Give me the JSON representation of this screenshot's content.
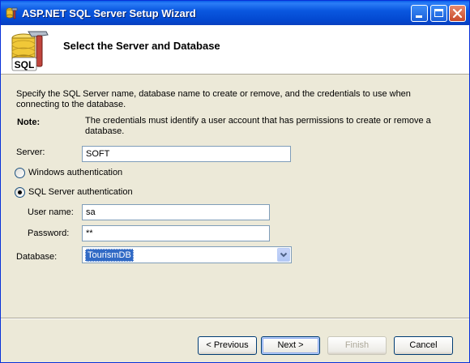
{
  "window": {
    "title": "ASP.NET SQL Server Setup Wizard"
  },
  "header": {
    "title": "Select the Server and Database",
    "icon_text": "SQL"
  },
  "intro": "Specify the SQL Server name, database name to create or remove, and the credentials to use when connecting to the database.",
  "note": {
    "label": "Note:",
    "text": "The credentials must identify a user account that has permissions to create or remove a database."
  },
  "server": {
    "label": "Server:",
    "value": "SOFT"
  },
  "auth": {
    "windows_label": "Windows authentication",
    "sql_label": "SQL Server authentication",
    "selected": "sql"
  },
  "username": {
    "label": "User name:",
    "value": "sa"
  },
  "password": {
    "label": "Password:",
    "value": "**"
  },
  "database": {
    "label": "Database:",
    "value": "TourismDB"
  },
  "buttons": {
    "previous": "< Previous",
    "next": "Next >",
    "finish": "Finish",
    "cancel": "Cancel"
  }
}
